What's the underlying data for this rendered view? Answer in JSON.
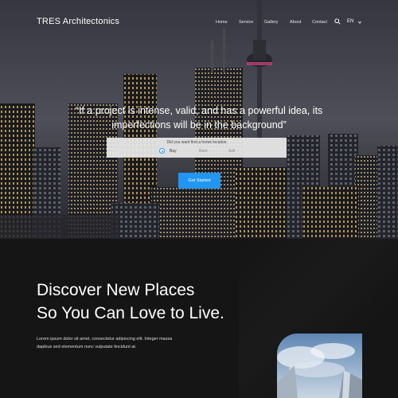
{
  "nav": {
    "brand": "TRES Architectonics",
    "links": [
      "Home",
      "Service",
      "Gallery",
      "About",
      "Contact"
    ],
    "language": "EN"
  },
  "hero": {
    "quote": "“If a project is intense, valid, and has a powerful idea, its imperfections will be in the background”",
    "search": {
      "title": "Did you want find a home location",
      "options": [
        "Buy",
        "Rent",
        "Sell"
      ],
      "selected": "Buy"
    },
    "cta_label": "Get Started"
  },
  "section": {
    "headline_line1": "Discover New Places",
    "headline_line2": "So You Can Love to Live.",
    "body_line1": "Lorem ipsum dolor sit amet, consectetur adipiscing elit. Integer massa",
    "body_line2": "dapibus sed elementum nunc vulputate tincidunt at."
  },
  "colors": {
    "accent": "#2196f3",
    "dark_bg": "#151515"
  },
  "icons": [
    "search-icon",
    "chevron-down-icon",
    "radio-selected-icon"
  ]
}
